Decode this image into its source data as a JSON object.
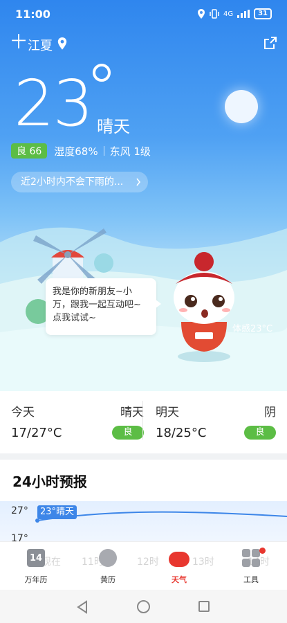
{
  "status_bar": {
    "time": "11:00",
    "network": "4G",
    "battery": "31"
  },
  "header": {
    "plus_symbol": "十",
    "city": "江夏"
  },
  "current": {
    "temperature": "23",
    "condition": "晴天",
    "aqi_label": "良 66",
    "humidity": "湿度68%",
    "wind": "东风 1级",
    "rain_notice": "近2小时内不会下雨的...",
    "feels_like": "体感23°C",
    "mascot_message": "我是你的新朋友~小万，跟我一起互动吧~点我试试~"
  },
  "days": [
    {
      "name": "今天",
      "condition": "晴天",
      "range": "17/27°C",
      "aqi": "良"
    },
    {
      "name": "明天",
      "condition": "阴",
      "range": "18/25°C",
      "aqi": "良"
    }
  ],
  "forecast_24h": {
    "title": "24小时预报",
    "y_max": "27°",
    "y_min": "17°",
    "tag": "23°晴天",
    "ghost_hours": [
      "现在",
      "11时",
      "12时",
      "13时",
      "14时"
    ]
  },
  "bottom_nav": [
    {
      "label": "万年历",
      "icon": "calendar-icon",
      "badge": "14"
    },
    {
      "label": "黄历",
      "icon": "yinyang-icon"
    },
    {
      "label": "天气",
      "icon": "weather-cloud-icon",
      "active": true
    },
    {
      "label": "工具",
      "icon": "tools-grid-icon"
    }
  ],
  "colors": {
    "accent": "#e8372f",
    "good_aqi": "#5cbd45",
    "sky_top": "#2f86ee"
  }
}
